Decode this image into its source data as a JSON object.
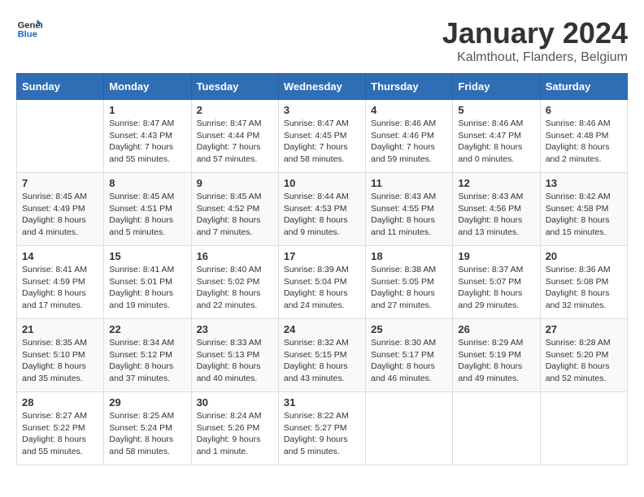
{
  "logo": {
    "line1": "General",
    "line2": "Blue"
  },
  "title": "January 2024",
  "subtitle": "Kalmthout, Flanders, Belgium",
  "days_of_week": [
    "Sunday",
    "Monday",
    "Tuesday",
    "Wednesday",
    "Thursday",
    "Friday",
    "Saturday"
  ],
  "weeks": [
    [
      {
        "day": "",
        "info": ""
      },
      {
        "day": "1",
        "info": "Sunrise: 8:47 AM\nSunset: 4:43 PM\nDaylight: 7 hours\nand 55 minutes."
      },
      {
        "day": "2",
        "info": "Sunrise: 8:47 AM\nSunset: 4:44 PM\nDaylight: 7 hours\nand 57 minutes."
      },
      {
        "day": "3",
        "info": "Sunrise: 8:47 AM\nSunset: 4:45 PM\nDaylight: 7 hours\nand 58 minutes."
      },
      {
        "day": "4",
        "info": "Sunrise: 8:46 AM\nSunset: 4:46 PM\nDaylight: 7 hours\nand 59 minutes."
      },
      {
        "day": "5",
        "info": "Sunrise: 8:46 AM\nSunset: 4:47 PM\nDaylight: 8 hours\nand 0 minutes."
      },
      {
        "day": "6",
        "info": "Sunrise: 8:46 AM\nSunset: 4:48 PM\nDaylight: 8 hours\nand 2 minutes."
      }
    ],
    [
      {
        "day": "7",
        "info": "Sunrise: 8:45 AM\nSunset: 4:49 PM\nDaylight: 8 hours\nand 4 minutes."
      },
      {
        "day": "8",
        "info": "Sunrise: 8:45 AM\nSunset: 4:51 PM\nDaylight: 8 hours\nand 5 minutes."
      },
      {
        "day": "9",
        "info": "Sunrise: 8:45 AM\nSunset: 4:52 PM\nDaylight: 8 hours\nand 7 minutes."
      },
      {
        "day": "10",
        "info": "Sunrise: 8:44 AM\nSunset: 4:53 PM\nDaylight: 8 hours\nand 9 minutes."
      },
      {
        "day": "11",
        "info": "Sunrise: 8:43 AM\nSunset: 4:55 PM\nDaylight: 8 hours\nand 11 minutes."
      },
      {
        "day": "12",
        "info": "Sunrise: 8:43 AM\nSunset: 4:56 PM\nDaylight: 8 hours\nand 13 minutes."
      },
      {
        "day": "13",
        "info": "Sunrise: 8:42 AM\nSunset: 4:58 PM\nDaylight: 8 hours\nand 15 minutes."
      }
    ],
    [
      {
        "day": "14",
        "info": "Sunrise: 8:41 AM\nSunset: 4:59 PM\nDaylight: 8 hours\nand 17 minutes."
      },
      {
        "day": "15",
        "info": "Sunrise: 8:41 AM\nSunset: 5:01 PM\nDaylight: 8 hours\nand 19 minutes."
      },
      {
        "day": "16",
        "info": "Sunrise: 8:40 AM\nSunset: 5:02 PM\nDaylight: 8 hours\nand 22 minutes."
      },
      {
        "day": "17",
        "info": "Sunrise: 8:39 AM\nSunset: 5:04 PM\nDaylight: 8 hours\nand 24 minutes."
      },
      {
        "day": "18",
        "info": "Sunrise: 8:38 AM\nSunset: 5:05 PM\nDaylight: 8 hours\nand 27 minutes."
      },
      {
        "day": "19",
        "info": "Sunrise: 8:37 AM\nSunset: 5:07 PM\nDaylight: 8 hours\nand 29 minutes."
      },
      {
        "day": "20",
        "info": "Sunrise: 8:36 AM\nSunset: 5:08 PM\nDaylight: 8 hours\nand 32 minutes."
      }
    ],
    [
      {
        "day": "21",
        "info": "Sunrise: 8:35 AM\nSunset: 5:10 PM\nDaylight: 8 hours\nand 35 minutes."
      },
      {
        "day": "22",
        "info": "Sunrise: 8:34 AM\nSunset: 5:12 PM\nDaylight: 8 hours\nand 37 minutes."
      },
      {
        "day": "23",
        "info": "Sunrise: 8:33 AM\nSunset: 5:13 PM\nDaylight: 8 hours\nand 40 minutes."
      },
      {
        "day": "24",
        "info": "Sunrise: 8:32 AM\nSunset: 5:15 PM\nDaylight: 8 hours\nand 43 minutes."
      },
      {
        "day": "25",
        "info": "Sunrise: 8:30 AM\nSunset: 5:17 PM\nDaylight: 8 hours\nand 46 minutes."
      },
      {
        "day": "26",
        "info": "Sunrise: 8:29 AM\nSunset: 5:19 PM\nDaylight: 8 hours\nand 49 minutes."
      },
      {
        "day": "27",
        "info": "Sunrise: 8:28 AM\nSunset: 5:20 PM\nDaylight: 8 hours\nand 52 minutes."
      }
    ],
    [
      {
        "day": "28",
        "info": "Sunrise: 8:27 AM\nSunset: 5:22 PM\nDaylight: 8 hours\nand 55 minutes."
      },
      {
        "day": "29",
        "info": "Sunrise: 8:25 AM\nSunset: 5:24 PM\nDaylight: 8 hours\nand 58 minutes."
      },
      {
        "day": "30",
        "info": "Sunrise: 8:24 AM\nSunset: 5:26 PM\nDaylight: 9 hours\nand 1 minute."
      },
      {
        "day": "31",
        "info": "Sunrise: 8:22 AM\nSunset: 5:27 PM\nDaylight: 9 hours\nand 5 minutes."
      },
      {
        "day": "",
        "info": ""
      },
      {
        "day": "",
        "info": ""
      },
      {
        "day": "",
        "info": ""
      }
    ]
  ]
}
